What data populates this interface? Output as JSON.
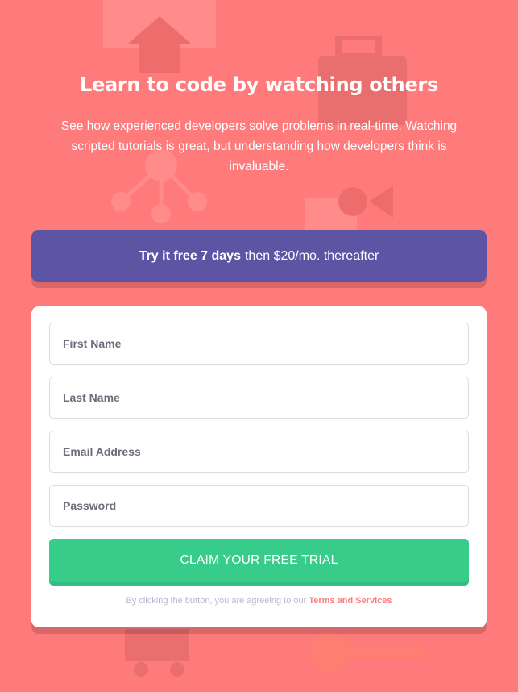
{
  "hero": {
    "title": "Learn to code by watching others",
    "description": "See how experienced developers solve problems in real-time. Watching scripted tutorials is great, but understanding how developers think is invaluable."
  },
  "promo": {
    "bold": "Try it free 7 days",
    "rest": "then $20/mo. thereafter"
  },
  "form": {
    "fields": [
      {
        "placeholder": "First Name",
        "value": ""
      },
      {
        "placeholder": "Last Name",
        "value": ""
      },
      {
        "placeholder": "Email Address",
        "value": ""
      },
      {
        "placeholder": "Password",
        "value": ""
      }
    ],
    "submit_label": "CLAIM YOUR FREE TRIAL",
    "terms_prefix": "By clicking the button, you are agreeing to our",
    "terms_link": "Terms and Services"
  },
  "colors": {
    "background": "#ff7a7a",
    "promo": "#5e54a4",
    "cta": "#38cc8b",
    "link": "#ff7a7a"
  }
}
